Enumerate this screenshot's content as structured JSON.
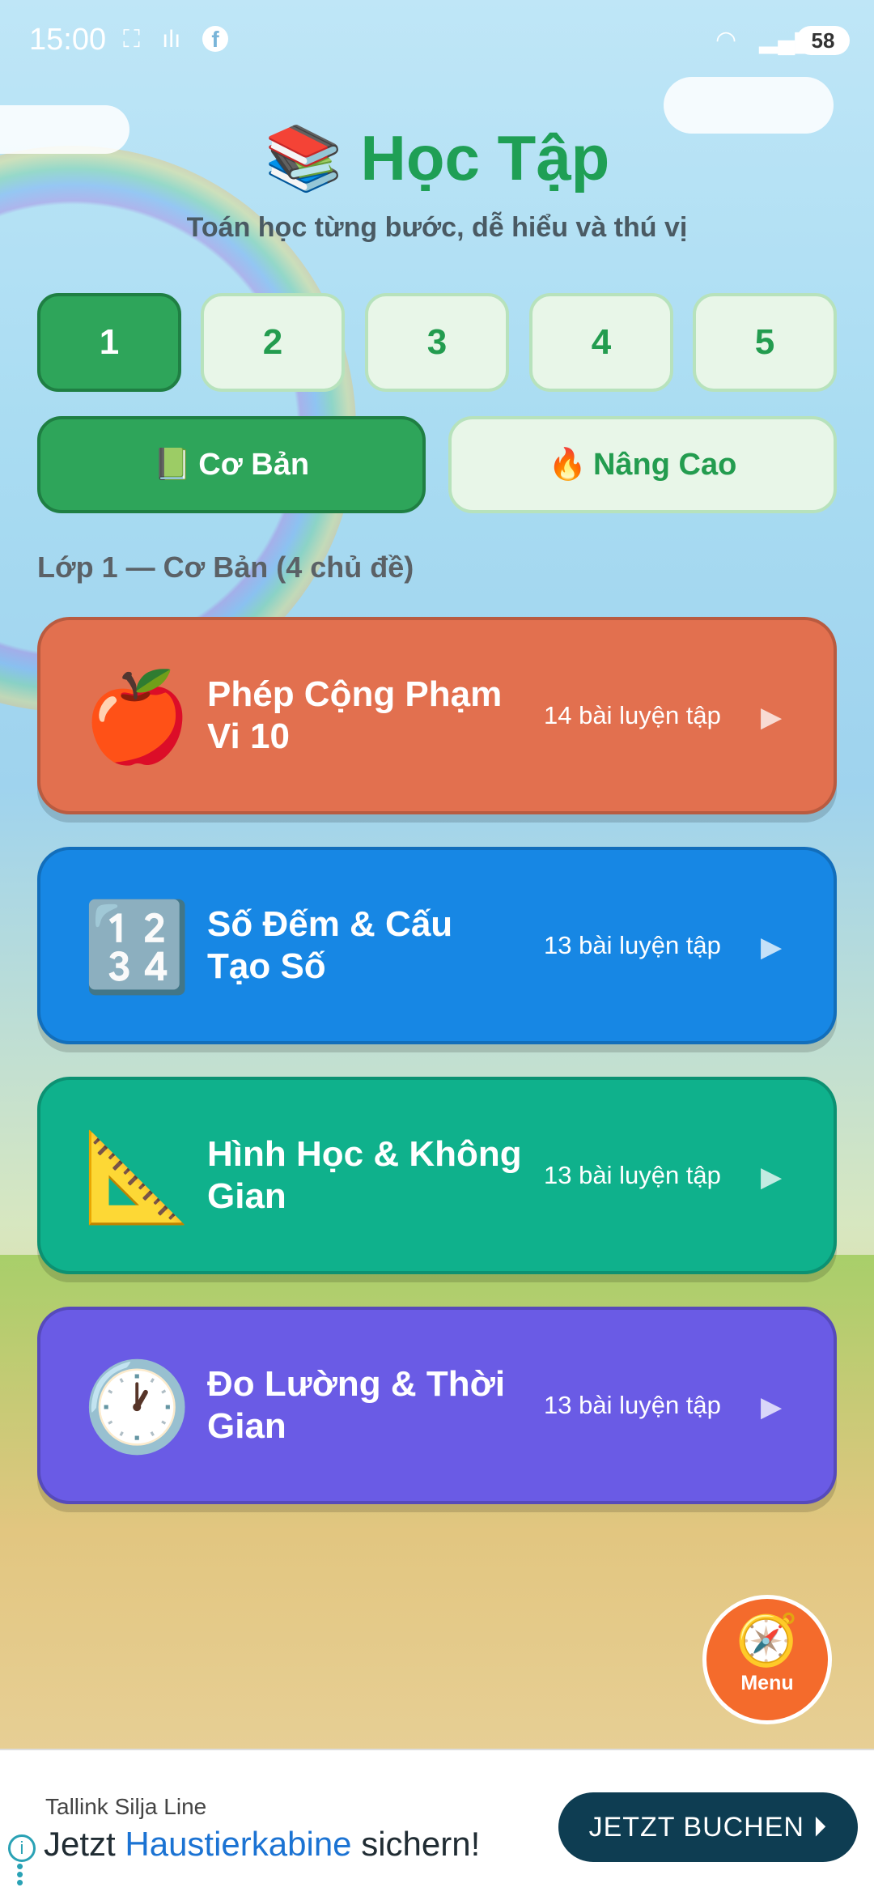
{
  "status_bar": {
    "time": "15:00",
    "battery": "58"
  },
  "header": {
    "title": "Học Tập",
    "title_icon": "📚",
    "subtitle": "Toán học từng bước, dễ hiểu và thú vị"
  },
  "grades": [
    {
      "label": "1",
      "active": true
    },
    {
      "label": "2",
      "active": false
    },
    {
      "label": "3",
      "active": false
    },
    {
      "label": "4",
      "active": false
    },
    {
      "label": "5",
      "active": false
    }
  ],
  "levels": [
    {
      "icon": "📗",
      "label": "Cơ Bản",
      "active": true
    },
    {
      "icon": "🔥",
      "label": "Nâng Cao",
      "active": false
    }
  ],
  "section_title": "Lớp 1 — Cơ Bản (4 chủ đề)",
  "topics": [
    {
      "emoji": "🍎",
      "name": "Phép Cộng Phạm Vi 10",
      "count": "14 bài luyện tập",
      "color": "#e2704f"
    },
    {
      "emoji": "🔢",
      "name": "Số Đếm & Cấu Tạo Số",
      "count": "13 bài luyện tập",
      "color": "#1787e4"
    },
    {
      "emoji": "📐",
      "name": "Hình Học & Không Gian",
      "count": "13 bài luyện tập",
      "color": "#0fb18c"
    },
    {
      "emoji": "🕐",
      "name": "Đo Lường & Thời Gian",
      "count": "13 bài luyện tập",
      "color": "#6a5be5"
    }
  ],
  "play_symbol": "▶",
  "fab": {
    "icon": "🧭",
    "label": "Menu"
  },
  "ad": {
    "brand": "Tallink Silja Line",
    "text_before": "Jetzt ",
    "text_highlight": "Haustierkabine",
    "text_after": " sichern!",
    "cta": "JETZT BUCHEN ⏵"
  }
}
